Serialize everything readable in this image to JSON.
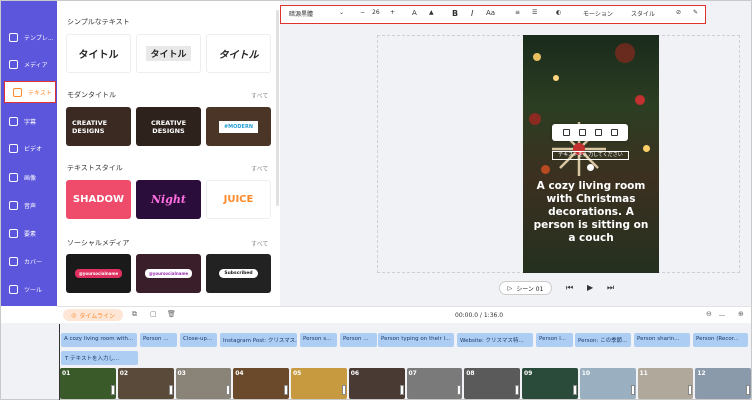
{
  "sidebar": {
    "items": [
      {
        "label": "テンプレ...",
        "icon": "template-icon"
      },
      {
        "label": "メディア",
        "icon": "media-icon"
      },
      {
        "label": "テキスト",
        "icon": "text-icon"
      },
      {
        "label": "字幕",
        "icon": "subtitle-icon"
      },
      {
        "label": "ビデオ",
        "icon": "video-icon"
      },
      {
        "label": "画像",
        "icon": "image-icon"
      },
      {
        "label": "音声",
        "icon": "audio-icon"
      },
      {
        "label": "要素",
        "icon": "elements-icon"
      },
      {
        "label": "カバー",
        "icon": "cover-icon"
      },
      {
        "label": "ツール",
        "icon": "tools-icon"
      }
    ]
  },
  "panel": {
    "simple": {
      "title": "シンプルなテキスト",
      "tiles": [
        "タイトル",
        "タイトル",
        "タイトル"
      ]
    },
    "modern": {
      "title": "モダンタイトル",
      "all": "すべて",
      "tiles": [
        "CREATIVE DESIGNS",
        "CREATIVE DESIGNS",
        "#MODERN"
      ]
    },
    "style": {
      "title": "テキストスタイル",
      "all": "すべて",
      "tiles": [
        "SHADOW",
        "Night",
        "JUICE"
      ]
    },
    "social": {
      "title": "ソーシャルメディア",
      "all": "すべて",
      "tiles": [
        "@yoursocialname",
        "@yoursocialname",
        "Subscribed"
      ]
    }
  },
  "toolbar": {
    "font": "暗源黒體",
    "size": "26",
    "minus": "−",
    "plus": "+",
    "color": "A",
    "bold": "B",
    "italic": "I",
    "case": "Aa",
    "motion": "モーション",
    "style": "スタイル"
  },
  "canvas": {
    "caption": "A cozy living room with Christmas decorations. A person is sitting on a couch",
    "selected_text": "テキストを入力してください"
  },
  "player": {
    "scene": "シーン 01"
  },
  "timeline": {
    "label": "タイムライン",
    "time": "00:00.0 / 1:36.0",
    "captions": [
      "A cozy living room with...",
      "Person ...",
      "Close-up...",
      "Instagram Post: クリスマス...",
      "Person s...",
      "Person ...",
      "Person typing on their l...",
      "Website: クリスマス特...",
      "Person l...",
      "Person: この季節...",
      "Person sharin...",
      "Person (Recor..."
    ],
    "text_clip": "テキストを入力し...",
    "thumbs": [
      "01",
      "02",
      "03",
      "04",
      "05",
      "06",
      "07",
      "08",
      "09",
      "10",
      "11",
      "12"
    ]
  },
  "colors": {
    "accent": "#5c56dc",
    "highlight": "#ff8a2b",
    "outline": "#e0322f",
    "caption": "#aecdf3"
  }
}
